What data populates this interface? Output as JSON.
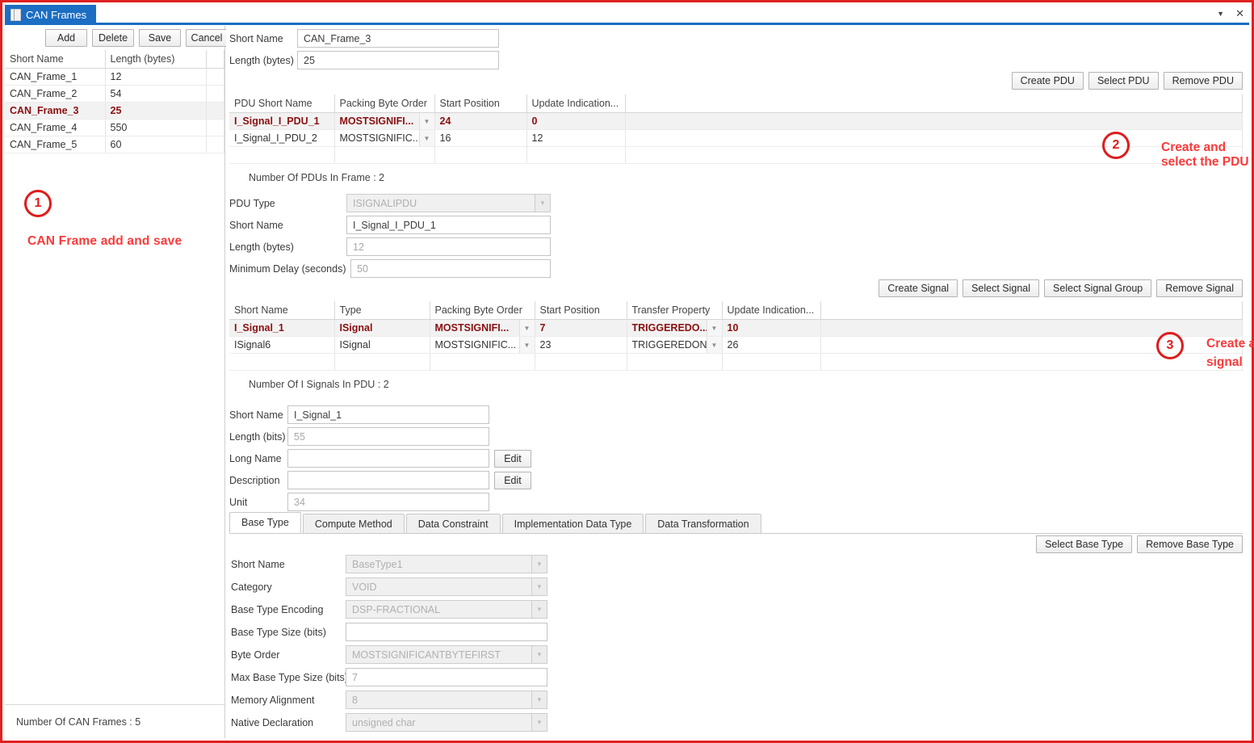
{
  "window": {
    "tab_title": "CAN Frames",
    "tab_icon": "document-icon",
    "minimize_icon": "caret-down-icon",
    "close_icon": "close-icon"
  },
  "left_pane": {
    "buttons": [
      {
        "label": "Add",
        "name": "add-button"
      },
      {
        "label": "Delete",
        "name": "delete-button"
      },
      {
        "label": "Save",
        "name": "save-button"
      },
      {
        "label": "Cancel",
        "name": "cancel-button"
      }
    ],
    "table": {
      "columns": [
        "Short Name",
        "Length (bytes)",
        ""
      ],
      "rows": [
        {
          "short_name": "CAN_Frame_1",
          "length": "12",
          "selected": false
        },
        {
          "short_name": "CAN_Frame_2",
          "length": "54",
          "selected": false
        },
        {
          "short_name": "CAN_Frame_3",
          "length": "25",
          "selected": true
        },
        {
          "short_name": "CAN_Frame_4",
          "length": "550",
          "selected": false
        },
        {
          "short_name": "CAN_Frame_5",
          "length": "60",
          "selected": false
        }
      ]
    },
    "status": "Number Of CAN Frames : 5"
  },
  "frame_detail": {
    "short_name_label": "Short Name",
    "short_name_value": "CAN_Frame_3",
    "length_label": "Length (bytes)",
    "length_value": "25"
  },
  "pdu_section": {
    "buttons": [
      {
        "label": "Create PDU",
        "name": "create-pdu-button"
      },
      {
        "label": "Select PDU",
        "name": "select-pdu-button"
      },
      {
        "label": "Remove PDU",
        "name": "remove-pdu-button"
      }
    ],
    "table": {
      "columns": [
        "PDU Short Name",
        "Packing Byte Order",
        "Start Position",
        "Update Indication...",
        ""
      ],
      "rows": [
        {
          "short_name": "I_Signal_I_PDU_1",
          "byte_order": "MOSTSIGNIFI...",
          "start_position": "24",
          "update_indication": "0",
          "selected": true
        },
        {
          "short_name": "I_Signal_I_PDU_2",
          "byte_order": "MOSTSIGNIFIC...",
          "start_position": "16",
          "update_indication": "12",
          "selected": false
        }
      ]
    },
    "count": "Number Of PDUs In Frame : 2"
  },
  "pdu_detail": {
    "fields": [
      {
        "label": "PDU Type",
        "value": "ISIGNALIPDU",
        "type": "combo",
        "readonly": true,
        "name": "pdu-type-combo"
      },
      {
        "label": "Short Name",
        "value": "I_Signal_I_PDU_1",
        "type": "text",
        "readonly": false,
        "name": "pdu-short-name-field"
      },
      {
        "label": "Length (bytes)",
        "value": "12",
        "type": "text",
        "readonly": false,
        "name": "pdu-length-field"
      },
      {
        "label": "Minimum Delay (seconds)",
        "value": "50",
        "type": "text",
        "readonly": false,
        "name": "pdu-minimum-delay-field"
      }
    ]
  },
  "signal_section": {
    "buttons": [
      {
        "label": "Create Signal",
        "name": "create-signal-button"
      },
      {
        "label": "Select Signal",
        "name": "select-signal-button"
      },
      {
        "label": "Select Signal Group",
        "name": "select-signal-group-button"
      },
      {
        "label": "Remove Signal",
        "name": "remove-signal-button"
      }
    ],
    "table": {
      "columns": [
        "Short Name",
        "Type",
        "Packing Byte Order",
        "Start Position",
        "Transfer Property",
        "Update Indication...",
        ""
      ],
      "rows": [
        {
          "short_name": "I_Signal_1",
          "type": "ISignal",
          "byte_order": "MOSTSIGNIFI...",
          "start_position": "7",
          "transfer_property": "TRIGGEREDO...",
          "update_indication": "10",
          "selected": true
        },
        {
          "short_name": "ISignal6",
          "type": "ISignal",
          "byte_order": "MOSTSIGNIFIC...",
          "start_position": "23",
          "transfer_property": "TRIGGEREDON...",
          "update_indication": "26",
          "selected": false
        }
      ]
    },
    "count": "Number Of I Signals In PDU : 2"
  },
  "signal_detail": {
    "fields": [
      {
        "label": "Short Name",
        "value": "I_Signal_1",
        "edit": false,
        "name": "signal-short-name-field"
      },
      {
        "label": "Length (bits)",
        "value": "55",
        "edit": false,
        "name": "signal-length-field"
      },
      {
        "label": "Long Name",
        "value": "",
        "edit": true,
        "name": "signal-long-name-field"
      },
      {
        "label": "Description",
        "value": "",
        "edit": true,
        "name": "signal-description-field"
      },
      {
        "label": "Unit",
        "value": "34",
        "edit": false,
        "name": "signal-unit-field"
      }
    ],
    "edit_label": "Edit"
  },
  "tabs": [
    {
      "label": "Base Type",
      "active": true,
      "name": "tab-base-type"
    },
    {
      "label": "Compute Method",
      "active": false,
      "name": "tab-compute-method"
    },
    {
      "label": "Data Constraint",
      "active": false,
      "name": "tab-data-constraint"
    },
    {
      "label": "Implementation Data Type",
      "active": false,
      "name": "tab-implementation-data-type"
    },
    {
      "label": "Data Transformation",
      "active": false,
      "name": "tab-data-transformation"
    }
  ],
  "base_type": {
    "buttons": [
      {
        "label": "Select Base Type",
        "name": "select-base-type-button"
      },
      {
        "label": "Remove Base Type",
        "name": "remove-base-type-button"
      }
    ],
    "fields": [
      {
        "label": "Short Name",
        "value": "BaseType1",
        "type": "combo",
        "name": "base-type-short-name-combo"
      },
      {
        "label": "Category",
        "value": "VOID",
        "type": "combo",
        "name": "base-type-category-combo"
      },
      {
        "label": "Base Type Encoding",
        "value": "DSP-FRACTIONAL",
        "type": "combo",
        "name": "base-type-encoding-combo"
      },
      {
        "label": "Base Type Size (bits)",
        "value": "",
        "type": "text",
        "name": "base-type-size-field"
      },
      {
        "label": "Byte Order",
        "value": "MOSTSIGNIFICANTBYTEFIRST",
        "type": "combo",
        "name": "base-type-byte-order-combo"
      },
      {
        "label": "Max Base Type Size (bits)",
        "value": "7",
        "type": "text",
        "name": "max-base-type-size-field"
      },
      {
        "label": "Memory Alignment",
        "value": "8",
        "type": "combo",
        "name": "memory-alignment-combo"
      },
      {
        "label": "Native Declaration",
        "value": "unsigned char",
        "type": "combo",
        "name": "native-declaration-combo"
      }
    ]
  },
  "annotations": [
    {
      "number": "1",
      "text": "CAN Frame add and save",
      "name": "annotation-1"
    },
    {
      "number": "2",
      "text": "Create and select the PDU",
      "name": "annotation-2"
    },
    {
      "number": "3",
      "text": "Create and select the signal",
      "name": "annotation-3"
    }
  ],
  "colors": {
    "accent": "#1b6ec2",
    "annotation": "#fb3a3a",
    "selected_row_text": "#8a1010"
  }
}
